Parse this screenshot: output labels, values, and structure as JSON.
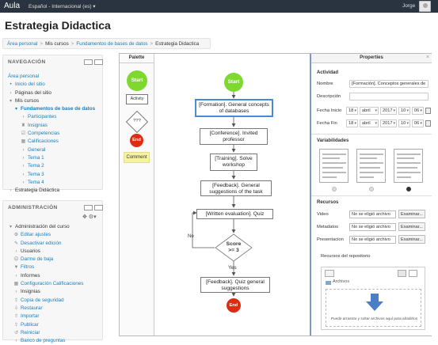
{
  "topbar": {
    "brand": "Aula",
    "language": "Español - Internacional (es) ▾",
    "user": "Jorge"
  },
  "page_title": "Estrategia Didactica",
  "breadcrumb": [
    "Área personal",
    "Mis cursos",
    "Fundamentos de bases de datos",
    "Estrategia Didactica"
  ],
  "navigation": {
    "title": "NAVEGACIÓN",
    "items": [
      {
        "label": "Área personal"
      },
      {
        "label": "Inicio del sitio"
      },
      {
        "label": "Páginas del sitio"
      },
      {
        "label": "Mis cursos"
      },
      {
        "label": "Fundamentos de base de datos"
      },
      {
        "label": "Participantes"
      },
      {
        "label": "Insignias"
      },
      {
        "label": "Competencias"
      },
      {
        "label": "Calificaciones"
      },
      {
        "label": "General"
      },
      {
        "label": "Tema 1"
      },
      {
        "label": "Tema 2"
      },
      {
        "label": "Tema 3"
      },
      {
        "label": "Tema 4"
      },
      {
        "label": "Estrategia Didáctica"
      }
    ]
  },
  "admin": {
    "title": "ADMINISTRACIÓN",
    "items": [
      {
        "label": "Administración del curso"
      },
      {
        "label": "Editar ajustes"
      },
      {
        "label": "Desactivar edición"
      },
      {
        "label": "Usuarios"
      },
      {
        "label": "Darme de baja"
      },
      {
        "label": "Filtros"
      },
      {
        "label": "Informes"
      },
      {
        "label": "Configuración Calificaciones"
      },
      {
        "label": "Insignias"
      },
      {
        "label": "Copia de seguridad"
      },
      {
        "label": "Restaurar"
      },
      {
        "label": "Importar"
      },
      {
        "label": "Publicar"
      },
      {
        "label": "Reiniciar"
      },
      {
        "label": "Banco de preguntas"
      }
    ]
  },
  "palette": {
    "title": "Palette",
    "start": "Start",
    "activity": "Activity",
    "decision": "???",
    "end": "End",
    "comment": "Comment"
  },
  "flow": {
    "start": "Start",
    "n1": "[Formation]. General concepts of databases",
    "n2": "[Conference]. Invited professor",
    "n3": "[Training]. Solve workshop",
    "n4": "[Feedback]. General suggestions of the task",
    "n5": "[Written evaluation]. Quiz",
    "decision": "Score >= 3",
    "yes": "Yes",
    "no": "No",
    "n6": "[Feedback]. Quiz general suggestions",
    "end": "End"
  },
  "properties": {
    "title": "Properties",
    "activity_section": "Actividad",
    "name_label": "Nombre",
    "name_value": "[Formación]. Conceptos generales de",
    "desc_label": "Descripción",
    "desc_value": "",
    "start_label": "Fecha Inicio",
    "start_date": {
      "day": "18",
      "month": "abril",
      "year": "2017",
      "hour": "10",
      "minute": "06"
    },
    "end_label": "Fecha Fin",
    "end_date": {
      "day": "18",
      "month": "abril",
      "year": "2017",
      "hour": "10",
      "minute": "06"
    },
    "variability_section": "Variabilidades",
    "resources_section": "Recursos",
    "resources": [
      {
        "label": "Video",
        "value": "No se eligió archivo",
        "button": "Examinar..."
      },
      {
        "label": "Metadatos",
        "value": "No se eligió archivo",
        "button": "Examinar..."
      },
      {
        "label": "Presentacion",
        "value": "No se eligió archivo",
        "button": "Examinar..."
      }
    ],
    "repo_label": "Recursos del repositorio",
    "folder": "Archivos",
    "drop_text": "Puede arrastrar y soltar archivos aquí para añadirlos"
  }
}
